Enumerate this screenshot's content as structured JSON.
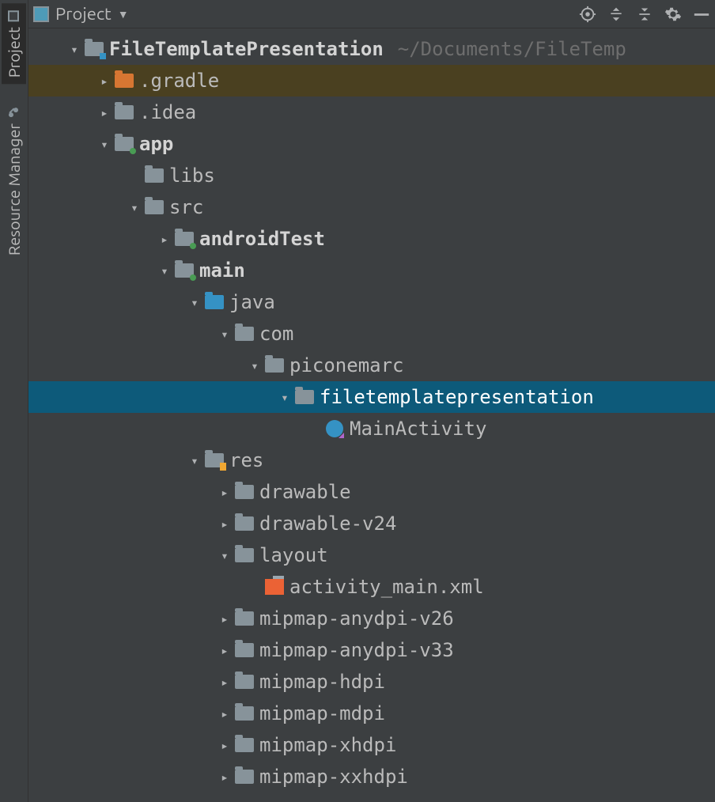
{
  "sidebar": {
    "tabs": [
      {
        "label": "Project",
        "active": true
      },
      {
        "label": "Resource Manager",
        "active": false
      }
    ]
  },
  "header": {
    "title": "Project"
  },
  "tree": {
    "root": {
      "name": "FileTemplatePresentation",
      "hint": "~/Documents/FileTemp"
    },
    "items": [
      {
        "name": ".gradle",
        "depth": 1,
        "arrow": "right",
        "icon": "folder-orange",
        "bold": false,
        "hl": true
      },
      {
        "name": ".idea",
        "depth": 1,
        "arrow": "right",
        "icon": "folder"
      },
      {
        "name": "app",
        "depth": 1,
        "arrow": "down",
        "icon": "folder-green",
        "bold": true
      },
      {
        "name": "libs",
        "depth": 2,
        "arrow": "none",
        "icon": "folder"
      },
      {
        "name": "src",
        "depth": 2,
        "arrow": "down",
        "icon": "folder"
      },
      {
        "name": "androidTest",
        "depth": 3,
        "arrow": "right",
        "icon": "folder-green",
        "bold": true
      },
      {
        "name": "main",
        "depth": 3,
        "arrow": "down",
        "icon": "folder-green",
        "bold": true
      },
      {
        "name": "java",
        "depth": 4,
        "arrow": "down",
        "icon": "folder-blue"
      },
      {
        "name": "com",
        "depth": 5,
        "arrow": "down",
        "icon": "pkg"
      },
      {
        "name": "piconemarc",
        "depth": 6,
        "arrow": "down",
        "icon": "pkg"
      },
      {
        "name": "filetemplatepresentation",
        "depth": 7,
        "arrow": "down",
        "icon": "pkg",
        "selected": true
      },
      {
        "name": "MainActivity",
        "depth": 8,
        "arrow": "none",
        "icon": "kotlin"
      },
      {
        "name": "res",
        "depth": 4,
        "arrow": "down",
        "icon": "folder-res"
      },
      {
        "name": "drawable",
        "depth": 5,
        "arrow": "right",
        "icon": "folder"
      },
      {
        "name": "drawable-v24",
        "depth": 5,
        "arrow": "right",
        "icon": "folder"
      },
      {
        "name": "layout",
        "depth": 5,
        "arrow": "down",
        "icon": "folder"
      },
      {
        "name": "activity_main.xml",
        "depth": 6,
        "arrow": "none",
        "icon": "xml"
      },
      {
        "name": "mipmap-anydpi-v26",
        "depth": 5,
        "arrow": "right",
        "icon": "folder"
      },
      {
        "name": "mipmap-anydpi-v33",
        "depth": 5,
        "arrow": "right",
        "icon": "folder"
      },
      {
        "name": "mipmap-hdpi",
        "depth": 5,
        "arrow": "right",
        "icon": "folder"
      },
      {
        "name": "mipmap-mdpi",
        "depth": 5,
        "arrow": "right",
        "icon": "folder"
      },
      {
        "name": "mipmap-xhdpi",
        "depth": 5,
        "arrow": "right",
        "icon": "folder"
      },
      {
        "name": "mipmap-xxhdpi",
        "depth": 5,
        "arrow": "right",
        "icon": "folder"
      }
    ]
  }
}
